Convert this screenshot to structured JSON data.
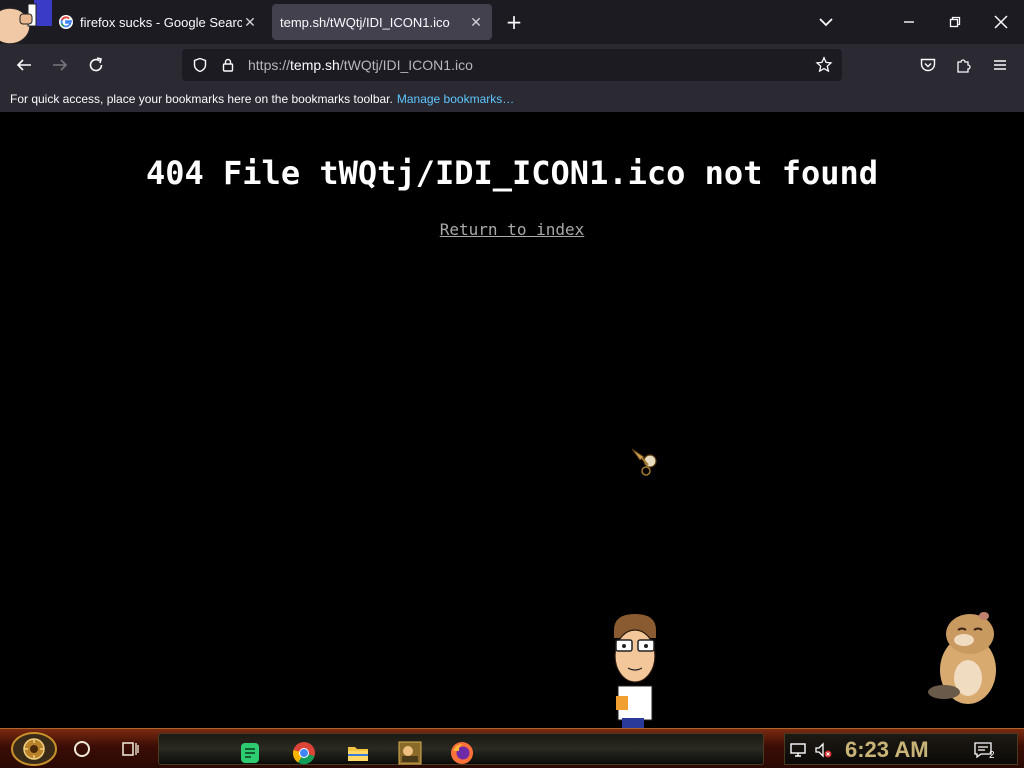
{
  "browser": {
    "tabs": [
      {
        "title": "firefox sucks - Google Search",
        "active": false,
        "favicon": "google-icon"
      },
      {
        "title": "temp.sh/tWQtj/IDI_ICON1.ico",
        "active": true,
        "favicon": "none"
      }
    ],
    "url": {
      "scheme": "https://",
      "host": "temp.sh",
      "path": "/tWQtj/IDI_ICON1.ico"
    },
    "bookmarks_toolbar": {
      "message": "For quick access, place your bookmarks here on the bookmarks toolbar.",
      "manage_link": "Manage bookmarks…"
    }
  },
  "page": {
    "title": "404 File tWQtj/IDI_ICON1.ico not found",
    "return_link": "Return to index"
  },
  "taskbar": {
    "apps": [
      "notes-app-icon",
      "chrome-icon",
      "file-explorer-icon",
      "game-app-icon",
      "firefox-icon"
    ],
    "clock": "6:23 AM",
    "notification_count": "2"
  },
  "colors": {
    "tab_strip": "#1c1b22",
    "toolbar": "#2b2a33",
    "link": "#5ec7ff",
    "page_bg": "#000000"
  }
}
